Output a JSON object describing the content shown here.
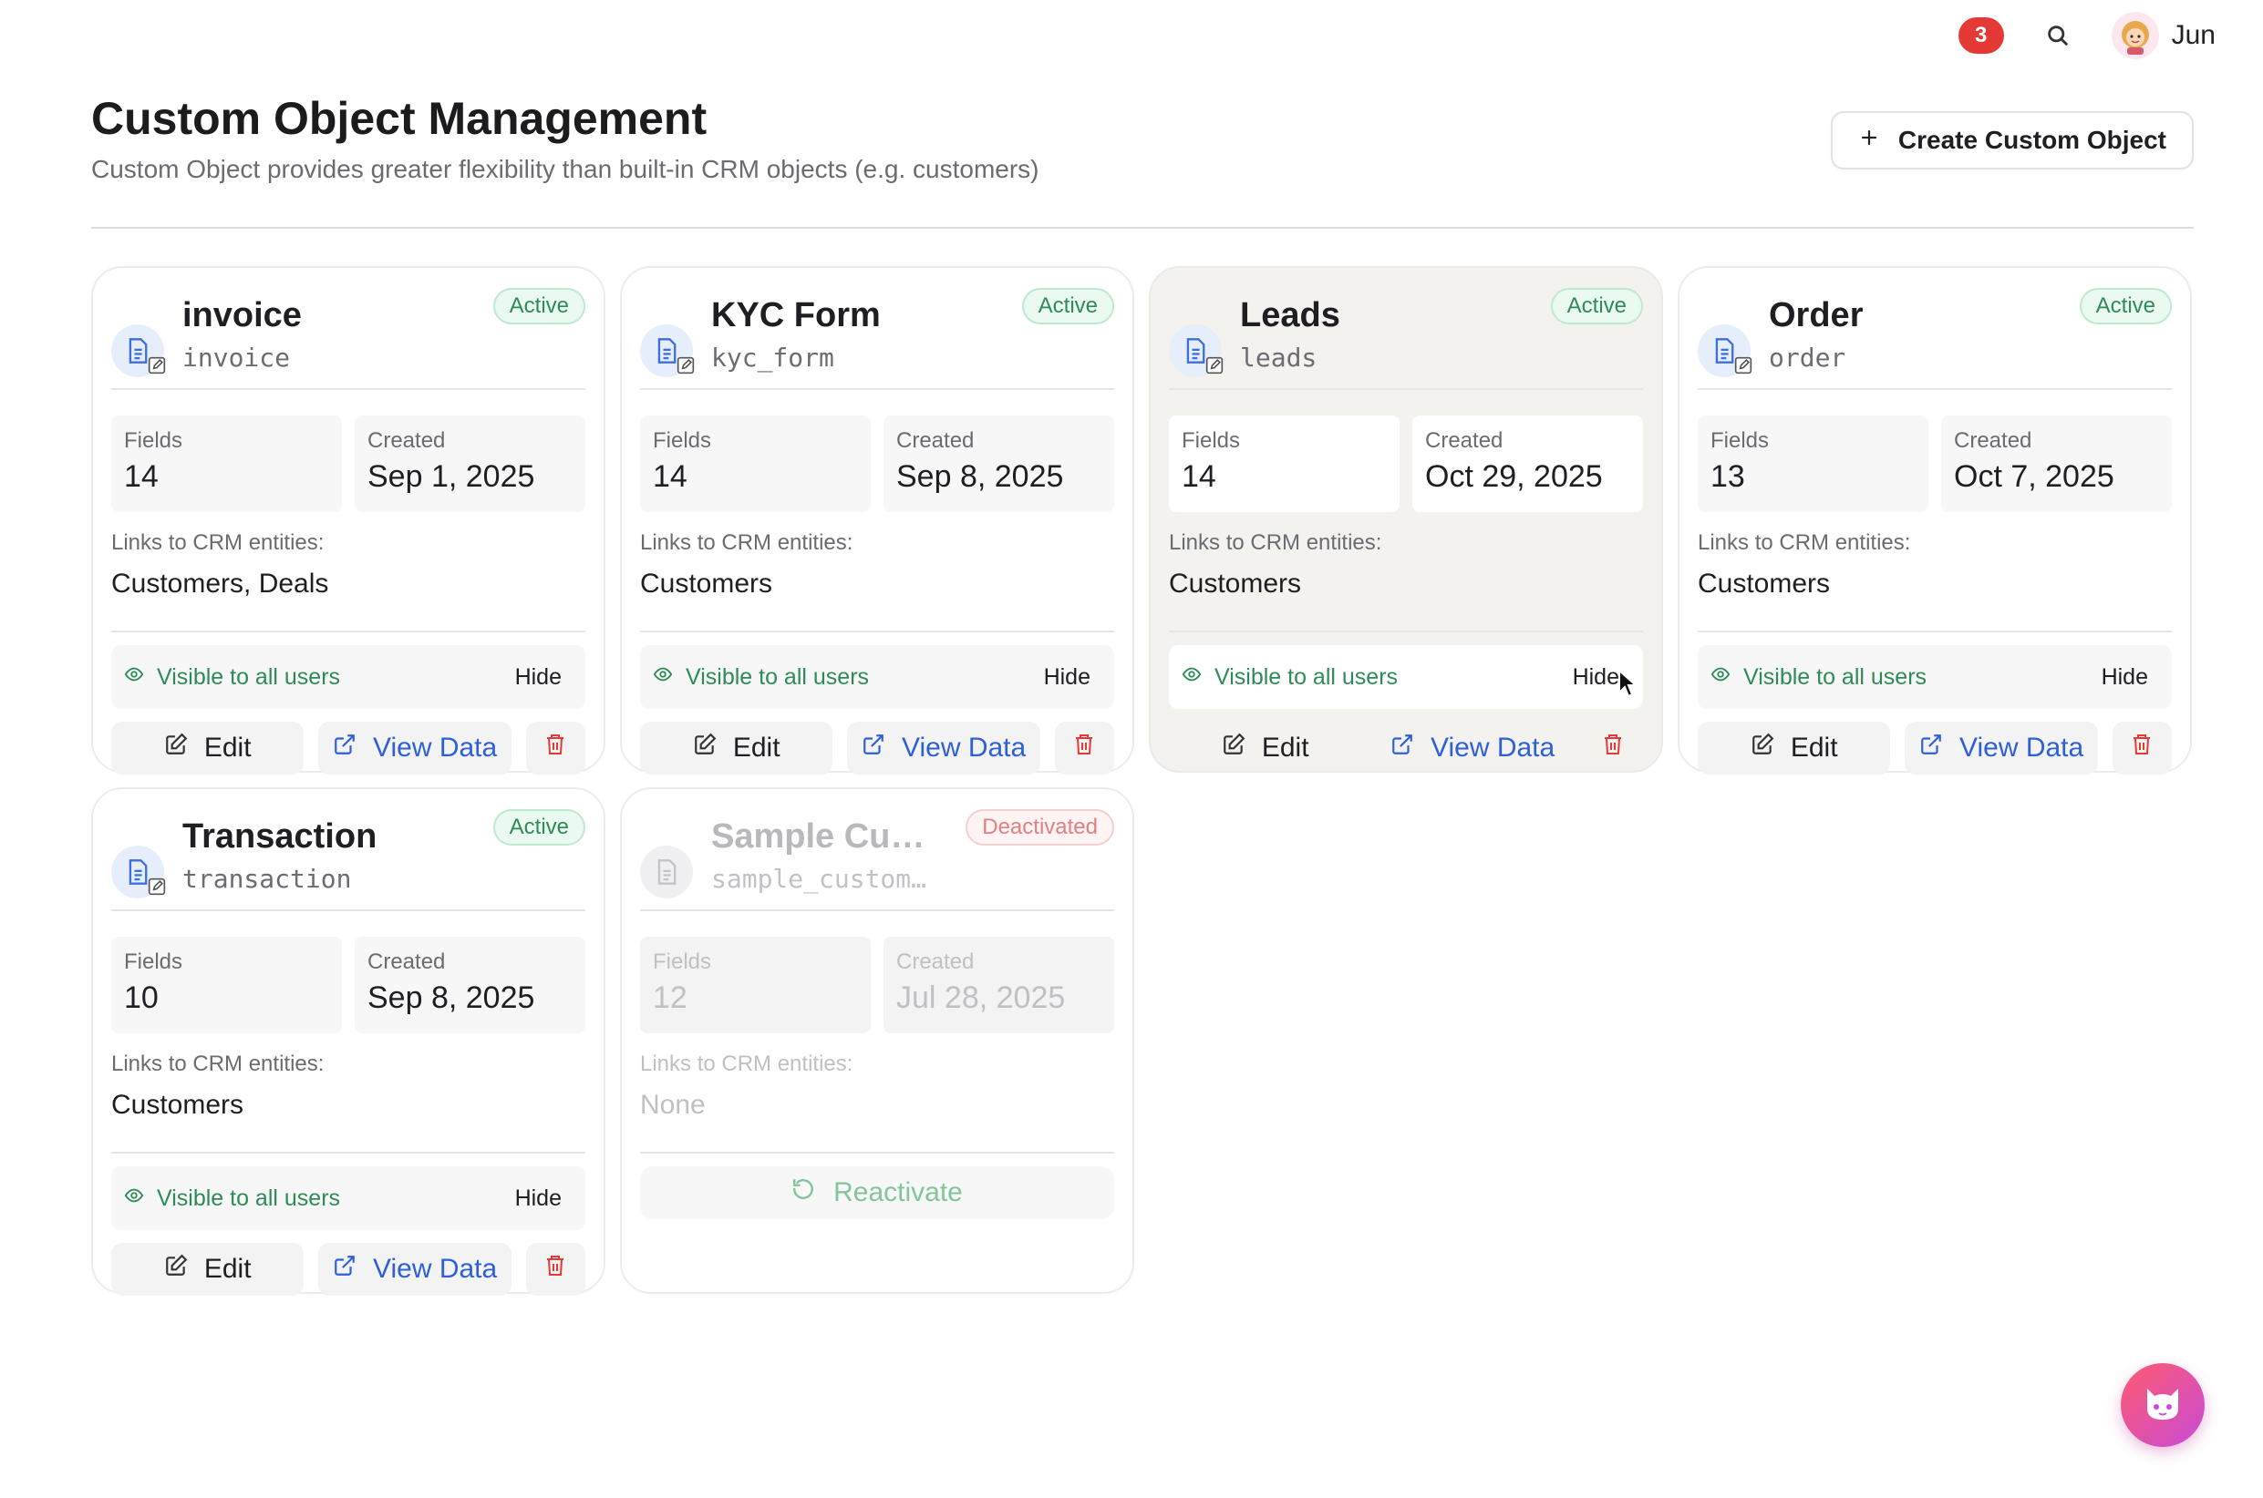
{
  "topbar": {
    "notification_count": "3",
    "user_name": "Jun"
  },
  "header": {
    "title": "Custom Object Management",
    "subtitle": "Custom Object provides greater flexibility than built-in CRM objects (e.g. customers)",
    "create_label": "Create Custom Object"
  },
  "labels": {
    "fields": "Fields",
    "created": "Created",
    "links": "Links to CRM entities:",
    "visible": "Visible to all users",
    "hide": "Hide",
    "edit": "Edit",
    "view_data": "View Data",
    "reactivate": "Reactivate"
  },
  "cards": [
    {
      "name": "invoice",
      "api": "invoice",
      "status": "Active",
      "fields": "14",
      "created": "Sep 1, 2025",
      "links": "Customers, Deals"
    },
    {
      "name": "KYC Form",
      "api": "kyc_form",
      "status": "Active",
      "fields": "14",
      "created": "Sep 8, 2025",
      "links": "Customers"
    },
    {
      "name": "Leads",
      "api": "leads",
      "status": "Active",
      "fields": "14",
      "created": "Oct 29, 2025",
      "links": "Customers"
    },
    {
      "name": "Order",
      "api": "order",
      "status": "Active",
      "fields": "13",
      "created": "Oct 7, 2025",
      "links": "Customers"
    },
    {
      "name": "Transaction",
      "api": "transaction",
      "status": "Active",
      "fields": "10",
      "created": "Sep 8, 2025",
      "links": "Customers"
    },
    {
      "name": "Sample Cust...",
      "api": "sample_custom...",
      "status": "Deactivated",
      "fields": "12",
      "created": "Jul 28, 2025",
      "links": "None"
    }
  ],
  "colors": {
    "active_green": "#2e8b57",
    "link_blue": "#2d5fd8",
    "danger_red": "#e53935"
  }
}
